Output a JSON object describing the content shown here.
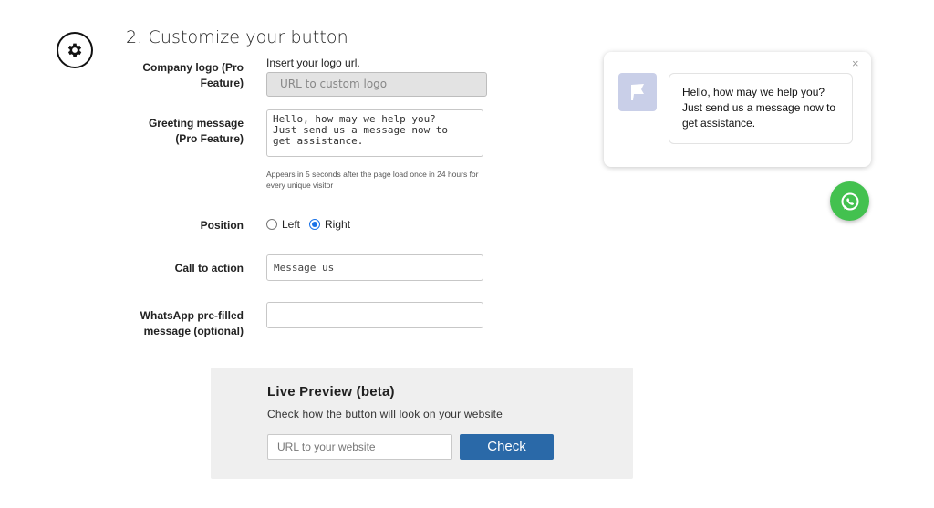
{
  "section": {
    "title": "2. Customize your button",
    "icon": "gear-icon"
  },
  "form": {
    "company_logo": {
      "label_line1": "Company logo (Pro",
      "label_line2": "Feature)",
      "hint": "Insert your logo url.",
      "placeholder": "URL to custom logo"
    },
    "greeting": {
      "label_line1": "Greeting message",
      "label_line2": "(Pro Feature)",
      "value": "Hello, how may we help you?\nJust send us a message now to\nget assistance.",
      "note": "Appears in 5 seconds after the page load once in 24 hours for every unique visitor"
    },
    "position": {
      "label": "Position",
      "options": [
        "Left",
        "Right"
      ],
      "selected": "Right"
    },
    "call_to_action": {
      "label": "Call to action",
      "placeholder": "Message us"
    },
    "prefilled": {
      "label_line1": "WhatsApp pre-filled",
      "label_line2": "message (optional)",
      "value": ""
    }
  },
  "live_preview": {
    "title": "Live Preview (beta)",
    "subtitle": "Check how the button will look on your website",
    "url_placeholder": "URL to your website",
    "check_label": "Check"
  },
  "widget": {
    "close": "×",
    "message": "Hello, how may we help you? Just send us a message now to get assistance.",
    "logo_icon": "flag-icon",
    "button_icon": "whatsapp-icon",
    "button_color": "#43c14f"
  },
  "colors": {
    "accent": "#2a69a8",
    "radio": "#1a73e8"
  }
}
